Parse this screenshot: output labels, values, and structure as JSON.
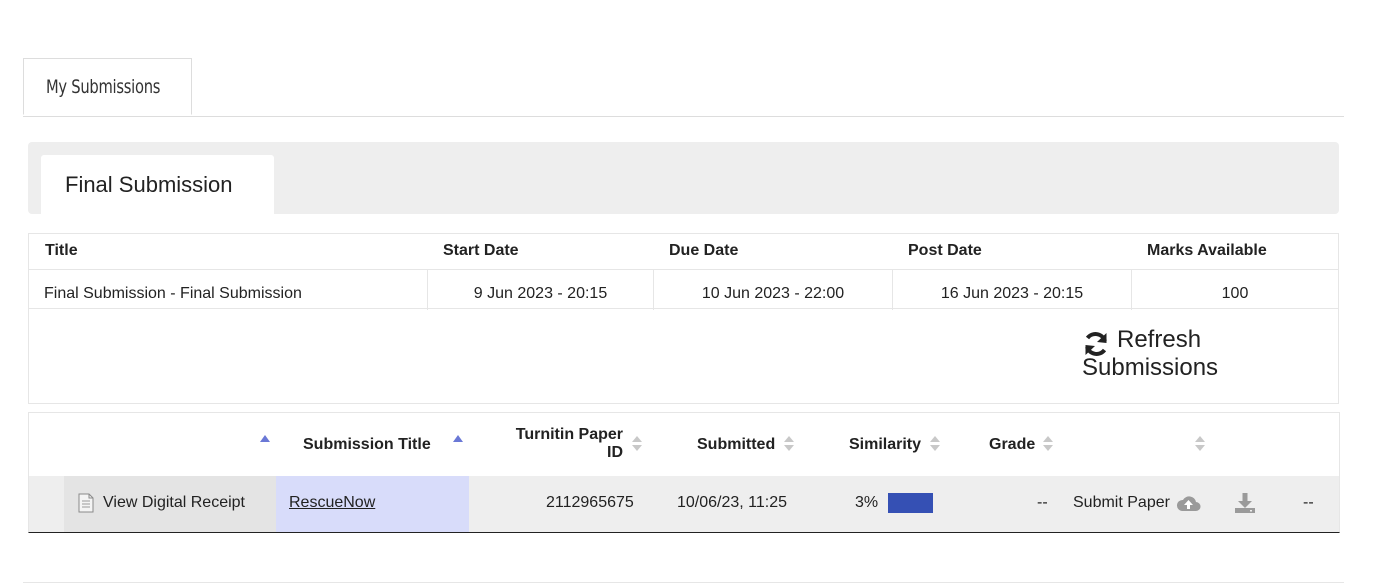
{
  "top_tab": {
    "label": "My Submissions"
  },
  "panel_tab": {
    "label": "Final Submission"
  },
  "info_table": {
    "headers": [
      "Title",
      "Start Date",
      "Due Date",
      "Post Date",
      "Marks Available"
    ],
    "row": {
      "title": "Final Submission - Final Submission",
      "start_date": "9 Jun 2023 - 20:15",
      "due_date": "10 Jun 2023 - 22:00",
      "post_date": "16 Jun 2023 - 20:15",
      "marks_available": "100"
    }
  },
  "refresh": {
    "line1": "Refresh",
    "line2": "Submissions",
    "icon": "refresh-icon"
  },
  "submissions_table": {
    "headers": {
      "submission_title": "Submission Title",
      "paper_id_line1": "Turnitin Paper",
      "paper_id_line2": "ID",
      "submitted": "Submitted",
      "similarity": "Similarity",
      "grade": "Grade"
    },
    "row": {
      "receipt_label": "View Digital Receipt",
      "submission_title": "RescueNow",
      "paper_id": "2112965675",
      "submitted": "10/06/23, 11:25",
      "similarity": "3%",
      "similarity_fraction": 0.03,
      "grade": "--",
      "submit_label": "Submit Paper",
      "last": "--"
    }
  },
  "colors": {
    "similarity_bar": "#3550b4",
    "title_highlight": "#d8dcfa",
    "sort_active": "#6a78d6",
    "panel_bg": "#eeeeee"
  }
}
